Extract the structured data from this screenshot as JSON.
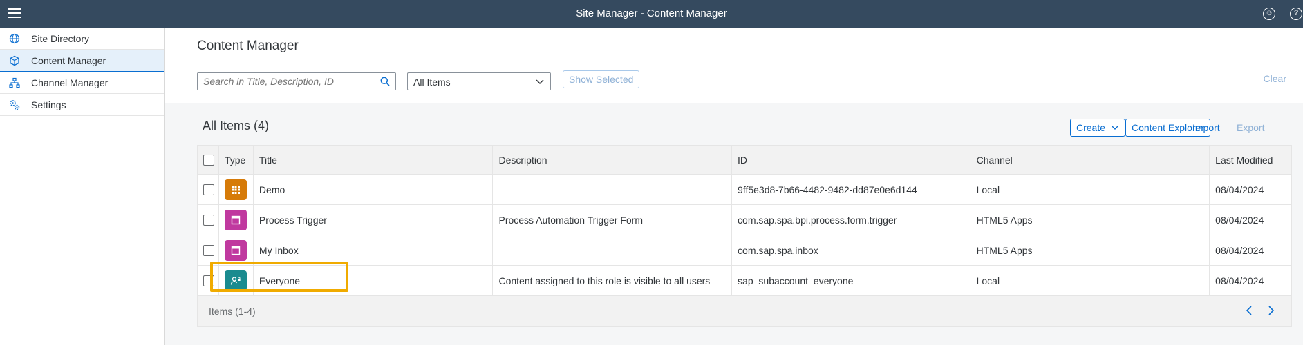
{
  "shell": {
    "title": "Site Manager - Content Manager",
    "icons": [
      "menu-icon",
      "user-icon",
      "help-icon"
    ]
  },
  "sidebar": {
    "items": [
      {
        "label": "Site Directory",
        "icon": "globe-icon",
        "selected": false
      },
      {
        "label": "Content Manager",
        "icon": "cube-icon",
        "selected": true
      },
      {
        "label": "Channel Manager",
        "icon": "hierarchy-icon",
        "selected": false
      },
      {
        "label": "Settings",
        "icon": "gears-icon",
        "selected": false
      }
    ]
  },
  "header": {
    "title": "Content Manager",
    "search_placeholder": "Search in Title, Description, ID",
    "filter_value": "All Items",
    "show_selected_label": "Show Selected",
    "clear_label": "Clear"
  },
  "table": {
    "title": "All Items (4)",
    "actions": {
      "create": "Create",
      "content_explorer": "Content Explorer",
      "import": "Import",
      "export": "Export"
    },
    "columns": [
      "Type",
      "Title",
      "Description",
      "ID",
      "Channel",
      "Last Modified"
    ],
    "rows": [
      {
        "type_icon": "app-grid-icon",
        "type_color": "#d67b09",
        "title": "Demo",
        "description": "",
        "id": "9ff5e3d8-7b66-4482-9482-dd87e0e6d144",
        "channel": "Local",
        "modified": "08/04/2024"
      },
      {
        "type_icon": "window-icon",
        "type_color": "#c0399f",
        "title": "Process Trigger",
        "description": "Process Automation Trigger Form",
        "id": "com.sap.spa.bpi.process.form.trigger",
        "channel": "HTML5 Apps",
        "modified": "08/04/2024"
      },
      {
        "type_icon": "window-icon",
        "type_color": "#c0399f",
        "title": "My Inbox",
        "description": "",
        "id": "com.sap.spa.inbox",
        "channel": "HTML5 Apps",
        "modified": "08/04/2024"
      },
      {
        "type_icon": "role-icon",
        "type_color": "#1a8b8f",
        "title": "Everyone",
        "description": "Content assigned to this role is visible to all users",
        "id": "sap_subaccount_everyone",
        "channel": "Local",
        "modified": "08/04/2024"
      }
    ],
    "footer": "Items (1-4)"
  },
  "colors": {
    "shell": "#354a5f",
    "accent": "#0a6ed1",
    "highlight": "#f0ab00"
  }
}
